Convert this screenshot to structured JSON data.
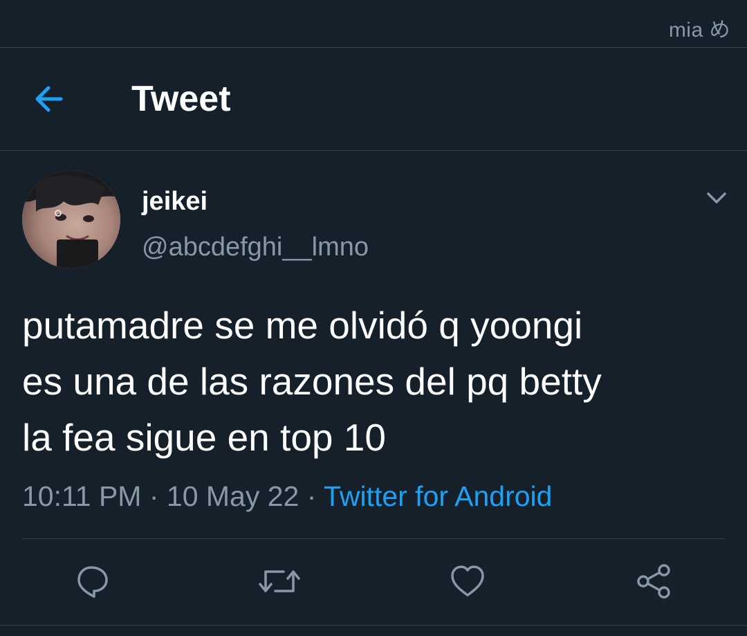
{
  "watermark": "mia め",
  "header": {
    "title": "Tweet",
    "back_icon": "arrow-left-icon"
  },
  "tweet": {
    "author": {
      "display_name": "jeikei",
      "handle": "@abcdefghi__lmno"
    },
    "text": "putamadre se me olvidó q yoongi\nes una de las razones del pq betty\nla fea sigue en top 10",
    "time": "10:11 PM",
    "sep1": " · ",
    "date": "10 May 22",
    "sep2": " · ",
    "source": "Twitter for Android"
  },
  "actions": [
    "reply-icon",
    "retweet-icon",
    "like-icon",
    "share-icon"
  ],
  "colors": {
    "background": "#15202b",
    "border": "#38444d",
    "secondary_text": "#8899a6",
    "accent": "#1da1f2",
    "primary_text": "#ffffff"
  }
}
